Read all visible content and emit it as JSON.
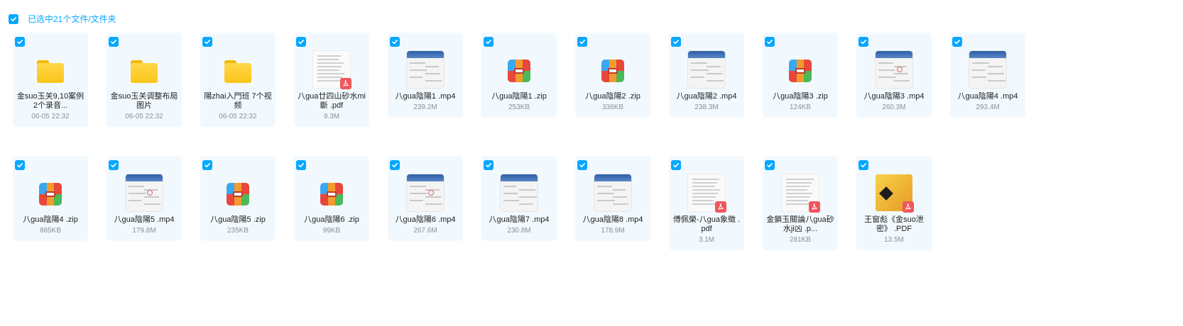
{
  "selection": {
    "label": "已选中21个文件/文件夹"
  },
  "colors": {
    "accent": "#06a7ff",
    "tile_background": "#f2f9fe",
    "meta_text": "#8a8f99"
  },
  "files": [
    {
      "name": "金suo玉关9,10案例 2个录音...",
      "meta": "06-05 22:32",
      "kind": "folder",
      "icon": "folder-icon"
    },
    {
      "name": "金suo玉关调整布局 图片",
      "meta": "06-05 22:32",
      "kind": "folder",
      "icon": "folder-icon"
    },
    {
      "name": "陽zhai入門班 7个视频",
      "meta": "06-05 22:32",
      "kind": "folder",
      "icon": "folder-icon"
    },
    {
      "name": "八gua廿四山砂水mi斷 .pdf",
      "meta": "9.3M",
      "kind": "pdf",
      "icon": "pdf-icon"
    },
    {
      "name": "八gua陰陽1 .mp4",
      "meta": "239.2M",
      "kind": "video",
      "icon": "video-thumbnail"
    },
    {
      "name": "八gua陰陽1 .zip",
      "meta": "253KB",
      "kind": "zip",
      "icon": "zip-archive-icon"
    },
    {
      "name": "八gua陰陽2 .zip",
      "meta": "336KB",
      "kind": "zip",
      "icon": "zip-archive-icon"
    },
    {
      "name": "八gua陰陽2 .mp4",
      "meta": "238.3M",
      "kind": "video",
      "icon": "video-thumbnail"
    },
    {
      "name": "八gua陰陽3 .zip",
      "meta": "124KB",
      "kind": "zip",
      "icon": "zip-archive-icon"
    },
    {
      "name": "八gua陰陽3 .mp4",
      "meta": "260.3M",
      "kind": "video",
      "icon": "video-thumbnail"
    },
    {
      "name": "八gua陰陽4 .mp4",
      "meta": "293.4M",
      "kind": "video",
      "icon": "video-thumbnail"
    },
    {
      "name": "八gua陰陽4 .zip",
      "meta": "885KB",
      "kind": "zip",
      "icon": "zip-archive-icon"
    },
    {
      "name": "八gua陰陽5 .mp4",
      "meta": "179.8M",
      "kind": "video",
      "icon": "video-thumbnail"
    },
    {
      "name": "八gua陰陽5 .zip",
      "meta": "235KB",
      "kind": "zip",
      "icon": "zip-archive-icon"
    },
    {
      "name": "八gua陰陽6 .zip",
      "meta": "99KB",
      "kind": "zip",
      "icon": "zip-archive-icon"
    },
    {
      "name": "八gua陰陽6 .mp4",
      "meta": "267.6M",
      "kind": "video",
      "icon": "video-thumbnail"
    },
    {
      "name": "八gua陰陽7 .mp4",
      "meta": "230.8M",
      "kind": "video",
      "icon": "video-thumbnail"
    },
    {
      "name": "八gua陰陽8 .mp4",
      "meta": "178.9M",
      "kind": "video",
      "icon": "video-thumbnail"
    },
    {
      "name": "傅佩榮-八gua象徵 .pdf",
      "meta": "3.1M",
      "kind": "pdf",
      "icon": "pdf-icon"
    },
    {
      "name": "金鎖玉關論八gua砂水ji凶 .p...",
      "meta": "281KB",
      "kind": "pdf",
      "icon": "pdf-icon"
    },
    {
      "name": "王窗彪《金suo泄密》 .PDF",
      "meta": "13.5M",
      "kind": "pdf-book",
      "icon": "pdf-icon"
    }
  ]
}
